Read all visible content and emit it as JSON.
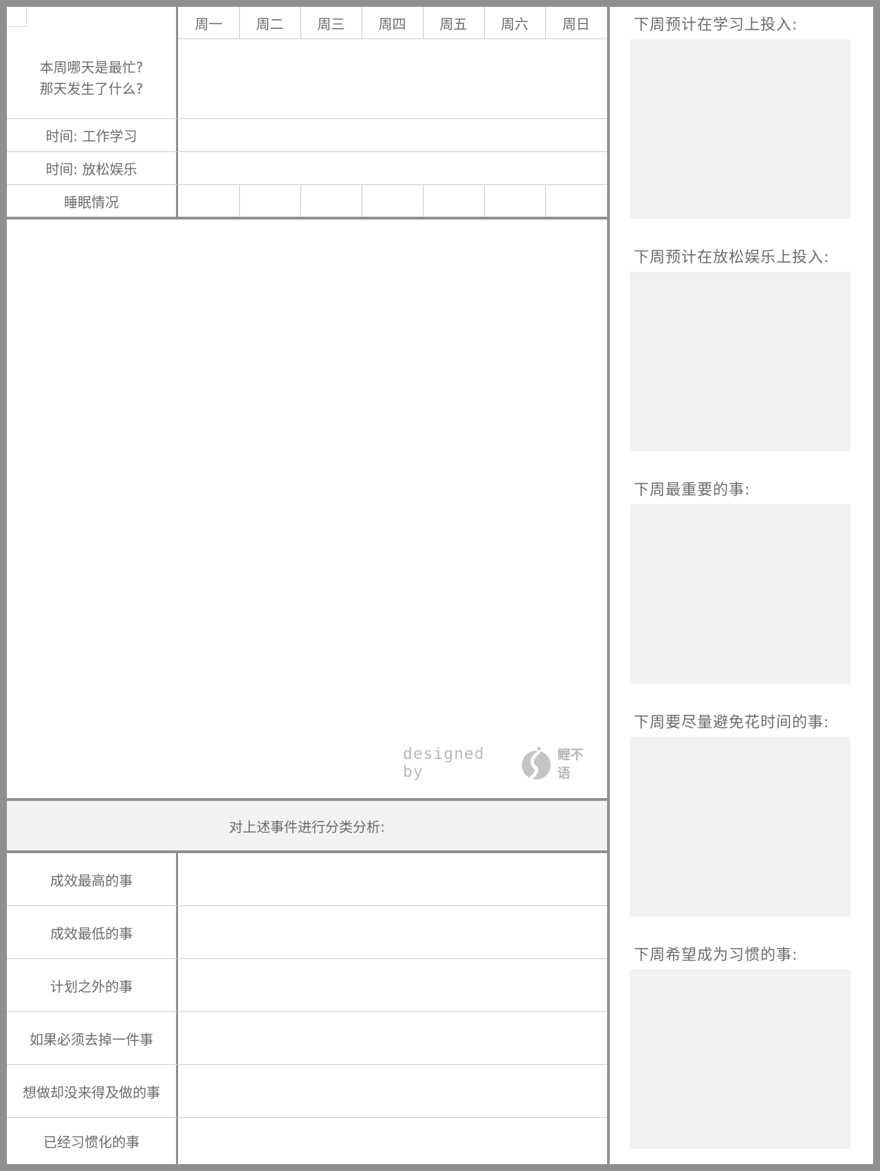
{
  "weekly": {
    "days": [
      "周一",
      "周二",
      "周三",
      "周四",
      "周五",
      "周六",
      "周日"
    ],
    "busiest_question_line1": "本周哪天是最忙?",
    "busiest_question_line2": "那天发生了什么?",
    "time_work": "时间: 工作学习",
    "time_relax": "时间: 放松娱乐",
    "sleep": "睡眠情况"
  },
  "branding": {
    "designed_by": "designed by",
    "brand_name": "鲤不语"
  },
  "analysis": {
    "header": "对上述事件进行分类分析:",
    "rows": [
      "成效最高的事",
      "成效最低的事",
      "计划之外的事",
      "如果必须去掉一件事",
      "想做却没来得及做的事",
      "已经习惯化的事"
    ]
  },
  "plan": {
    "items": [
      "下周预计在学习上投入:",
      "下周预计在放松娱乐上投入:",
      "下周最重要的事:",
      "下周要尽量避免花时间的事:",
      "下周希望成为习惯的事:"
    ]
  }
}
